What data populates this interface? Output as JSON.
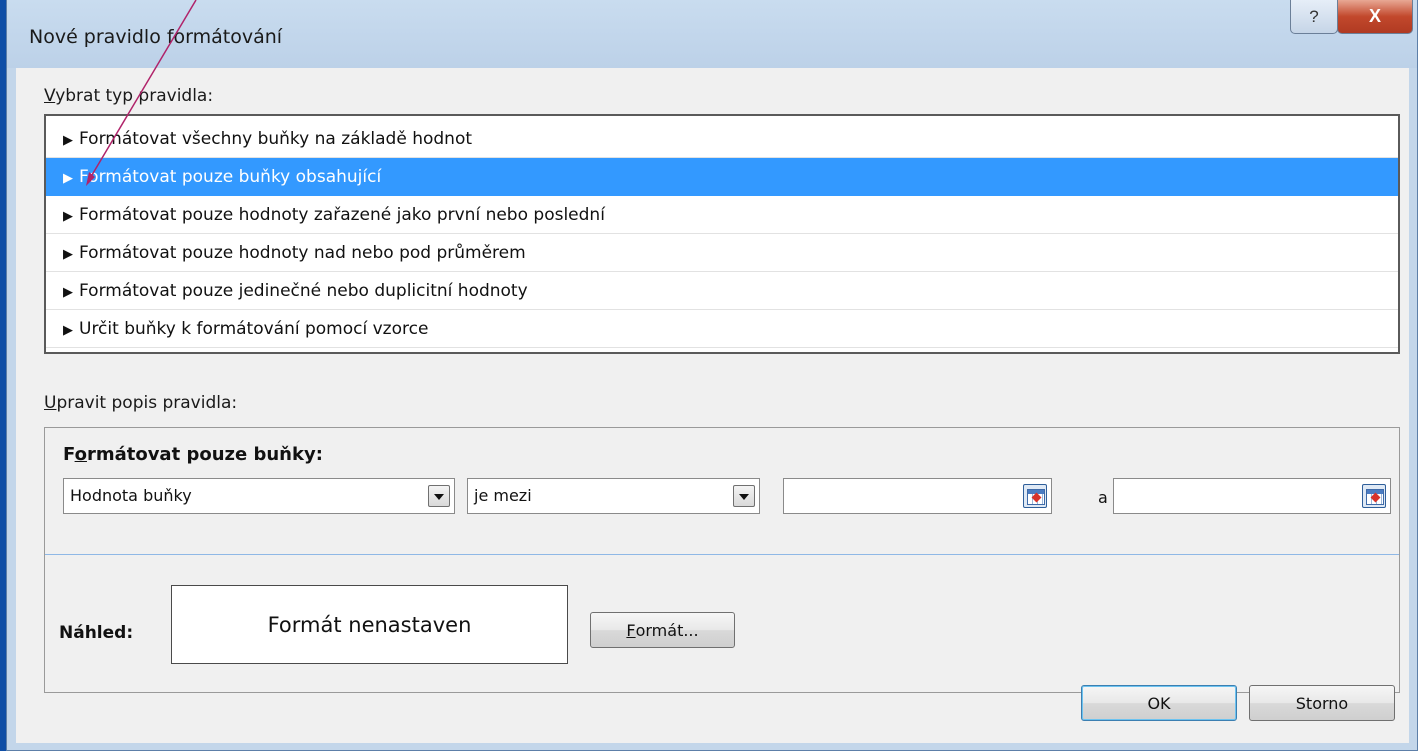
{
  "dialog": {
    "title": "Nové pravidlo formátování",
    "help_label": "?",
    "close_label": "X"
  },
  "rule_type": {
    "label_accel": "V",
    "label_rest": "ybrat typ pravidla:",
    "items": [
      "Formátovat všechny buňky na základě hodnot",
      "Formátovat pouze buňky obsahující",
      "Formátovat pouze hodnoty zařazené jako první nebo poslední",
      "Formátovat pouze hodnoty nad nebo pod průměrem",
      "Formátovat pouze jedinečné nebo duplicitní hodnoty",
      "Určit buňky k formátování pomocí vzorce"
    ],
    "selected_index": 1
  },
  "description": {
    "label_accel": "U",
    "label_rest": "pravit popis pravidla:",
    "heading_pre": "F",
    "heading_accel": "o",
    "heading_rest": "rmátovat pouze buňky:",
    "condition_type": "Hodnota buňky",
    "operator": "je mezi",
    "value1": "",
    "and_label": "a",
    "value2": ""
  },
  "preview": {
    "label": "Náhled:",
    "text": "Formát nenastaven",
    "format_button_accel": "F",
    "format_button_rest": "ormát..."
  },
  "buttons": {
    "ok": "OK",
    "cancel": "Storno"
  },
  "colors": {
    "selection": "#3399ff",
    "annotation_arrow": "#b0236a"
  }
}
